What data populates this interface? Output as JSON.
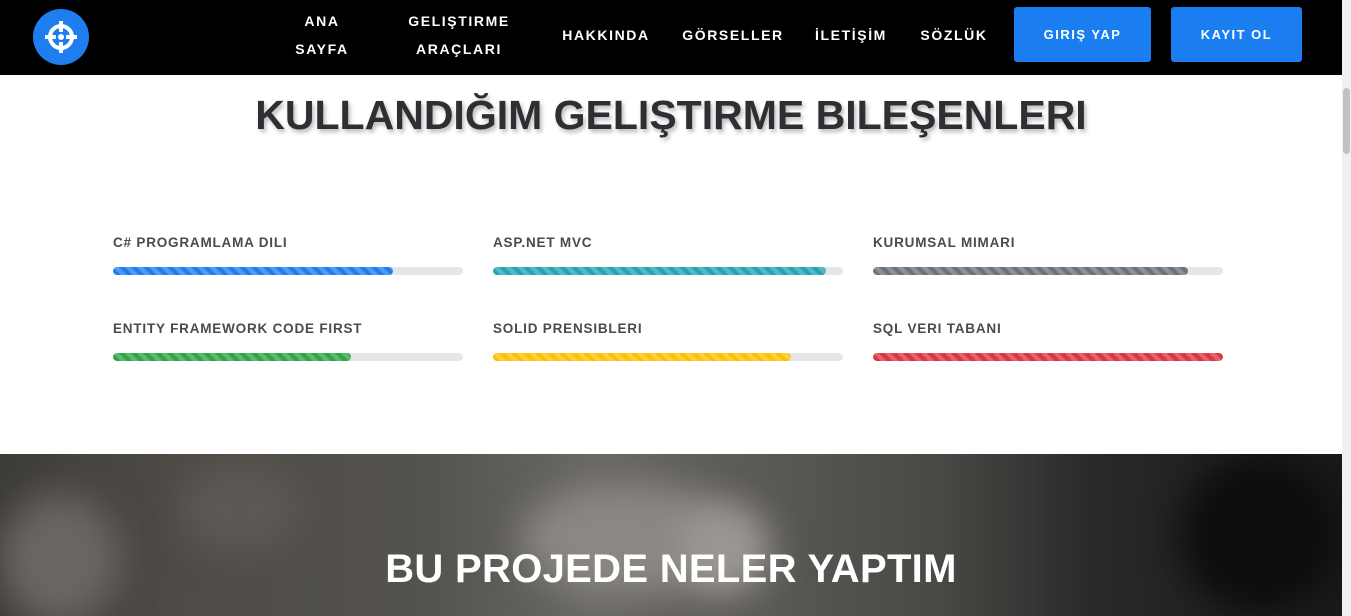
{
  "nav": {
    "logo_icon": "crosshair-icon",
    "links": {
      "home": "ANA\nSAYFA",
      "dev_tools": "GELIŞTIRME\nARAÇLARI",
      "about": "HAKKINDA",
      "gallery": "GÖRSELLER",
      "contact": "İLETİŞİM",
      "dictionary": "SÖZLÜK"
    },
    "login_label": "GIRIŞ YAP",
    "signup_label": "KAYIT OL"
  },
  "skills": {
    "title": "KULLANDIĞIM GELIŞTIRME BILEŞENLERI",
    "items": [
      {
        "label": "C# PROGRAMLAMA DILI",
        "percent": 80,
        "color": "#1e7ef0"
      },
      {
        "label": "ASP.NET MVC",
        "percent": 95,
        "color": "#25a5b2"
      },
      {
        "label": "KURUMSAL MIMARI",
        "percent": 90,
        "color": "#6d737a"
      },
      {
        "label": "ENTITY FRAMEWORK CODE FIRST",
        "percent": 68,
        "color": "#2fa546"
      },
      {
        "label": "SOLID PRENSIBLERI",
        "percent": 85,
        "color": "#fbc108"
      },
      {
        "label": "SQL VERI TABANI",
        "percent": 100,
        "color": "#dc3545"
      }
    ]
  },
  "project": {
    "title": "BU PROJEDE NELER YAPTIM"
  },
  "colors": {
    "navbar_bg": "#000000",
    "accent": "#1b7ef0"
  }
}
